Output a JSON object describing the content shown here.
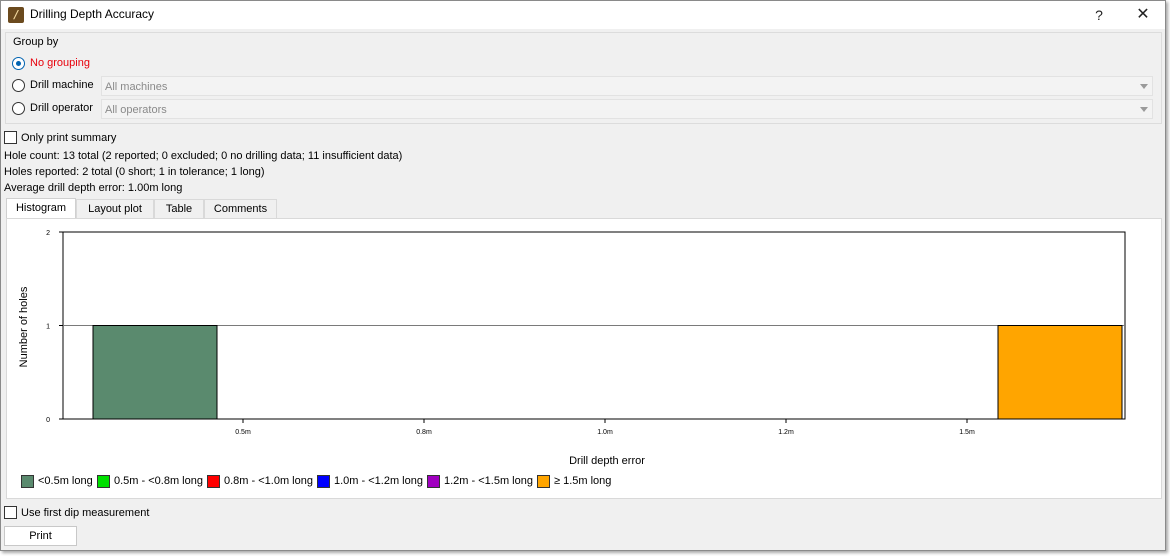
{
  "window": {
    "title": "Drilling Depth Accuracy",
    "help_label": "?",
    "close_label": "✕",
    "app_icon": "drill-app-icon"
  },
  "group_by": {
    "legend": "Group by",
    "options": [
      {
        "label": "No grouping",
        "selected": true
      },
      {
        "label": "Drill machine",
        "selected": false,
        "combo_value": "All machines"
      },
      {
        "label": "Drill operator",
        "selected": false,
        "combo_value": "All operators"
      }
    ]
  },
  "only_print_summary": {
    "label": "Only print summary",
    "checked": false
  },
  "summary": {
    "hole_count": "Hole count: 13 total (2 reported; 0 excluded; 0 no drilling data; 11 insufficient data)",
    "holes_reported": "Holes reported: 2 total (0 short; 1 in tolerance; 1 long)",
    "average_error": "Average drill depth error: 1.00m long"
  },
  "tabs": [
    {
      "label": "Histogram",
      "active": true
    },
    {
      "label": "Layout plot",
      "active": false
    },
    {
      "label": "Table",
      "active": false
    },
    {
      "label": "Comments",
      "active": false
    }
  ],
  "chart_data": {
    "type": "bar",
    "xlabel": "Drill depth error",
    "ylabel": "Number of holes",
    "xticks": [
      "0.5m",
      "0.8m",
      "1.0m",
      "1.2m",
      "1.5m"
    ],
    "yticks": [
      "0",
      "1",
      "2"
    ],
    "ylim": [
      0,
      2
    ],
    "grid": "horizontal",
    "bars": [
      {
        "bin": 0,
        "value": 1,
        "color": "#5a8a6e"
      },
      {
        "bin": 5,
        "value": 1,
        "color": "#ffa500"
      }
    ],
    "legend": [
      {
        "label": "<0.5m long",
        "color": "#5a8a6e"
      },
      {
        "label": "0.5m - <0.8m long",
        "color": "#00e000"
      },
      {
        "label": "0.8m - <1.0m long",
        "color": "#ff0000"
      },
      {
        "label": "1.0m - <1.2m long",
        "color": "#0000ff"
      },
      {
        "label": "1.2m - <1.5m long",
        "color": "#a000c0"
      },
      {
        "label": "≥ 1.5m long",
        "color": "#ffa500"
      }
    ]
  },
  "use_first_dip": {
    "label": "Use first dip measurement",
    "checked": false
  },
  "print_button": {
    "label": "Print"
  }
}
